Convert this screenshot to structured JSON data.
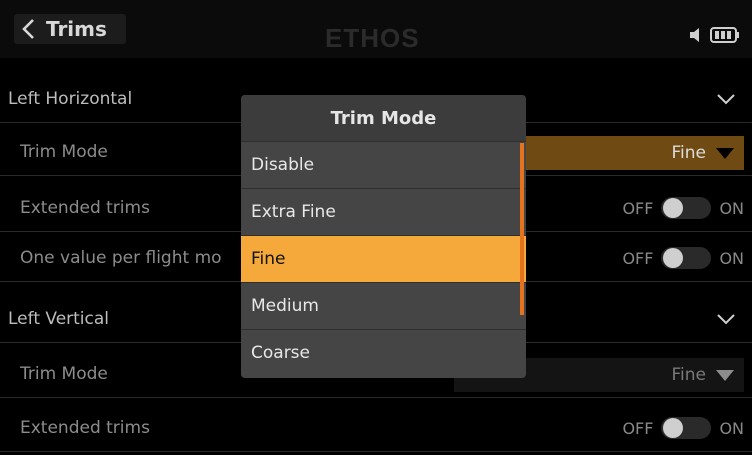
{
  "header": {
    "title": "Trims",
    "logo": "ETHOS",
    "icons": [
      "back-chevron-icon",
      "speaker-icon",
      "battery-icon"
    ]
  },
  "rows": [
    {
      "label": "Left Horizontal",
      "type": "section"
    },
    {
      "label": "Trim Mode",
      "value": "Fine"
    },
    {
      "label": "Extended trims",
      "off": "OFF",
      "on": "ON"
    },
    {
      "label": "One value per flight mo",
      "off": "OFF",
      "on": "ON"
    },
    {
      "label": "Left Vertical",
      "type": "section"
    },
    {
      "label": "Trim Mode",
      "value": "Fine"
    },
    {
      "label": "Extended trims",
      "off": "OFF",
      "on": "ON"
    }
  ],
  "modal": {
    "title": "Trim Mode",
    "options": [
      "Disable",
      "Extra Fine",
      "Fine",
      "Medium",
      "Coarse"
    ],
    "selected": "Fine"
  },
  "colors": {
    "accent": "#f4a93a",
    "active_select": "#6f4a12",
    "scrollbar": "#e5731d"
  }
}
